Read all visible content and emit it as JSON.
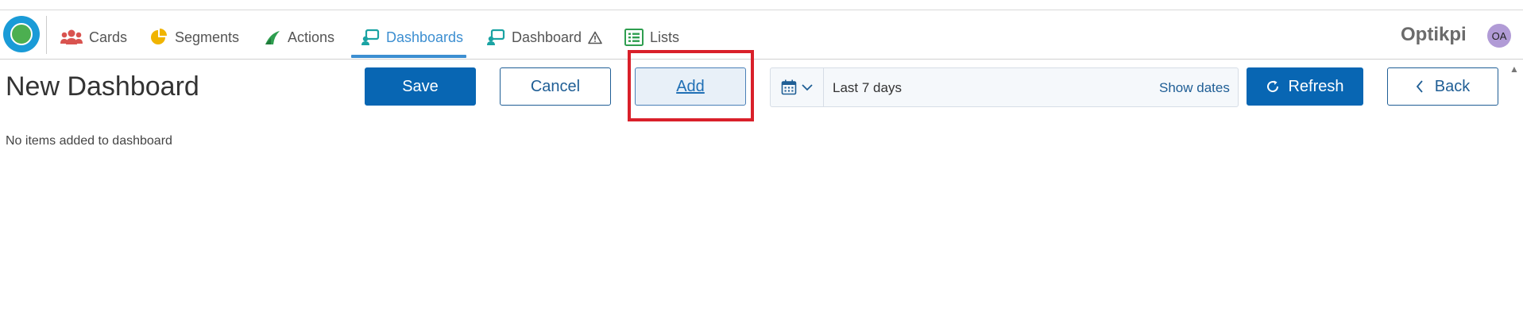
{
  "nav": {
    "items": [
      {
        "label": "Cards",
        "icon": "users-icon",
        "color": "#d9534f"
      },
      {
        "label": "Segments",
        "icon": "pie-chart-icon",
        "color": "#f0b400"
      },
      {
        "label": "Actions",
        "icon": "sail-icon",
        "color": "#2e9e4f"
      },
      {
        "label": "Dashboards",
        "icon": "dashboard-icon",
        "color": "#1aa3a3",
        "active": true
      },
      {
        "label": "Dashboard",
        "icon": "dashboard-icon",
        "color": "#1aa3a3",
        "badge_icon": "warning-icon"
      },
      {
        "label": "Lists",
        "icon": "list-icon",
        "color": "#2e9e4f"
      }
    ],
    "brand": "Optikpi",
    "avatar_initials": "OA"
  },
  "page": {
    "title": "New Dashboard",
    "empty_message": "No items added to dashboard"
  },
  "toolbar": {
    "save_label": "Save",
    "cancel_label": "Cancel",
    "add_label": "Add",
    "refresh_label": "Refresh",
    "back_label": "Back"
  },
  "daterange": {
    "value": "Last 7 days",
    "show_dates_label": "Show dates"
  },
  "colors": {
    "primary": "#0866b3",
    "accent": "#3d8fd1",
    "highlight": "#d9202a"
  }
}
